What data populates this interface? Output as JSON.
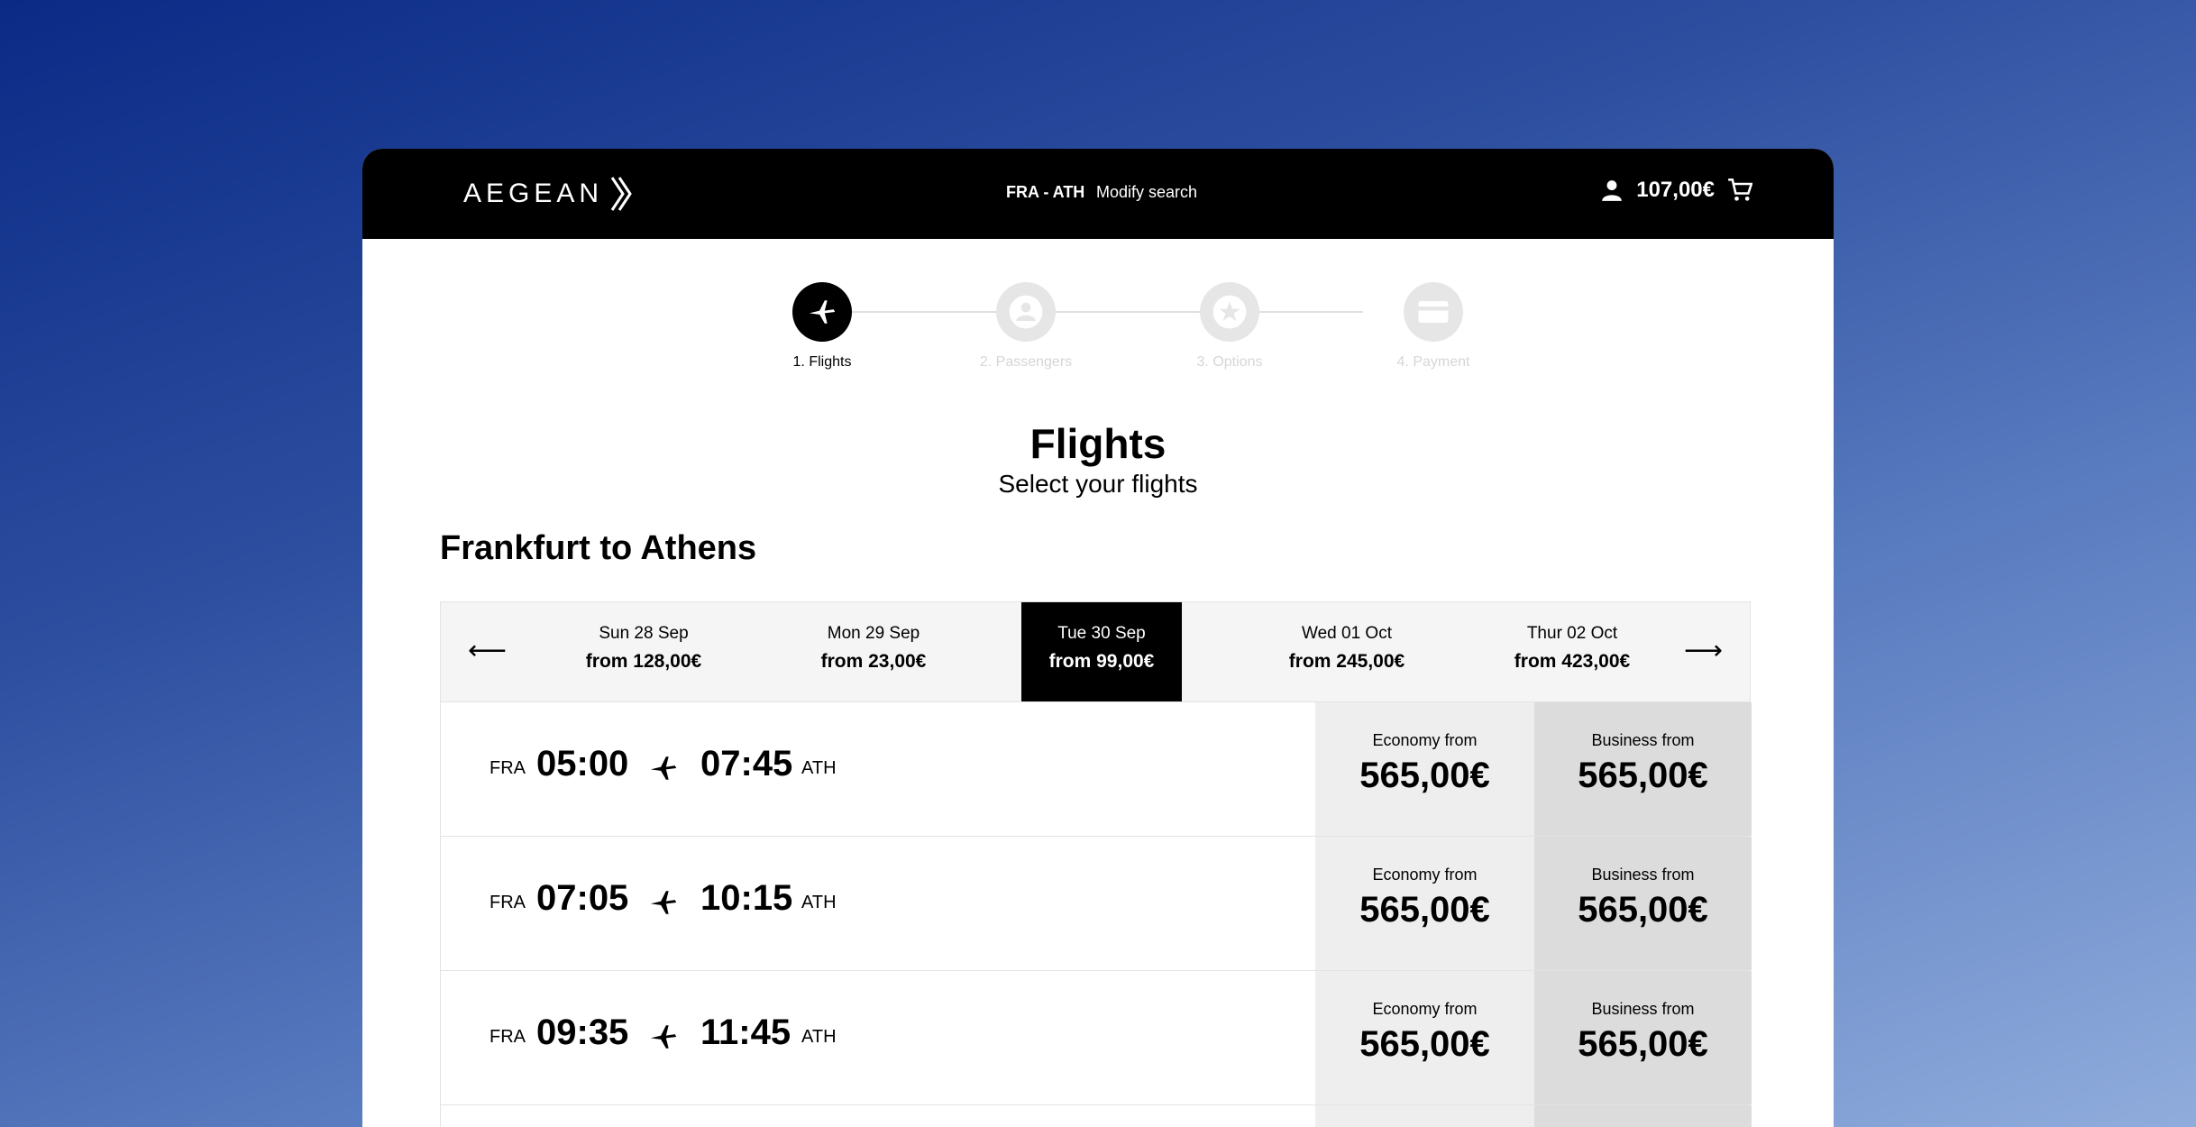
{
  "header": {
    "logo_text": "AEGEAN",
    "route": "FRA - ATH",
    "modify_label": "Modify search",
    "cart_total": "107,00€"
  },
  "steps": [
    {
      "label": "1. Flights",
      "icon": "plane-icon",
      "active": true
    },
    {
      "label": "2. Passengers",
      "icon": "person-icon",
      "active": false
    },
    {
      "label": "3. Options",
      "icon": "star-icon",
      "active": false
    },
    {
      "label": "4. Payment",
      "icon": "card-icon",
      "active": false
    }
  ],
  "page": {
    "title": "Flights",
    "subtitle": "Select your flights",
    "route_title": "Frankfurt to Athens"
  },
  "dates": [
    {
      "day": "Sun 28 Sep",
      "price": "from 128,00€",
      "selected": false
    },
    {
      "day": "Mon 29 Sep",
      "price": "from 23,00€",
      "selected": false
    },
    {
      "day": "Tue 30 Sep",
      "price": "from 99,00€",
      "selected": true
    },
    {
      "day": "Wed 01 Oct",
      "price": "from 245,00€",
      "selected": false
    },
    {
      "day": "Thur 02 Oct",
      "price": "from 423,00€",
      "selected": false
    }
  ],
  "flights": [
    {
      "from": "FRA",
      "dep": "05:00",
      "arr": "07:45",
      "to": "ATH",
      "economy_label": "Economy from",
      "economy_price": "565,00€",
      "business_label": "Business from",
      "business_price": "565,00€"
    },
    {
      "from": "FRA",
      "dep": "07:05",
      "arr": "10:15",
      "to": "ATH",
      "economy_label": "Economy from",
      "economy_price": "565,00€",
      "business_label": "Business from",
      "business_price": "565,00€"
    },
    {
      "from": "FRA",
      "dep": "09:35",
      "arr": "11:45",
      "to": "ATH",
      "economy_label": "Economy from",
      "economy_price": "565,00€",
      "business_label": "Business from",
      "business_price": "565,00€"
    }
  ],
  "colors": {
    "accent": "#000000",
    "inactive_step": "#e6e6e6",
    "economy_bg": "#eeeeee",
    "business_bg": "#dcdcdc"
  }
}
